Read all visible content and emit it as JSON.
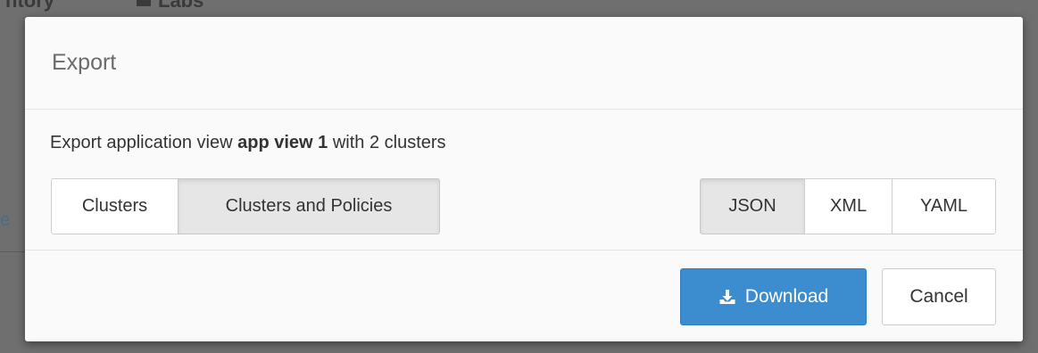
{
  "dialog": {
    "title": "Export",
    "description": {
      "prefix": "Export application view ",
      "app_name": "app view 1",
      "suffix": " with 2 clusters"
    },
    "scope_options": [
      {
        "label": "Clusters",
        "active": false
      },
      {
        "label": "Clusters and Policies",
        "active": true
      }
    ],
    "format_options": [
      {
        "label": "JSON",
        "active": true
      },
      {
        "label": "XML",
        "active": false
      },
      {
        "label": "YAML",
        "active": false
      }
    ],
    "download_label": "Download",
    "cancel_label": "Cancel"
  },
  "icons": {
    "download": "download-icon"
  },
  "colors": {
    "primary": "#3c8dcf",
    "overlay": "#6f6f6f",
    "active_toggle": "#e6e6e6"
  }
}
